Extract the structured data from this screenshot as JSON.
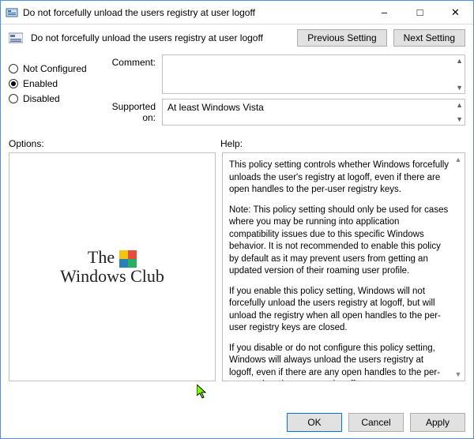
{
  "window": {
    "title": "Do not forcefully unload the users registry at user logoff"
  },
  "header": {
    "policy_name": "Do not forcefully unload the users registry at user logoff",
    "previous": "Previous Setting",
    "next": "Next Setting"
  },
  "state": {
    "not_configured": "Not Configured",
    "enabled": "Enabled",
    "disabled": "Disabled",
    "selected": "enabled"
  },
  "fields": {
    "comment_label": "Comment:",
    "comment_value": "",
    "supported_label": "Supported on:",
    "supported_value": "At least Windows Vista"
  },
  "labels": {
    "options": "Options:",
    "help": "Help:"
  },
  "watermark": {
    "line1": "The",
    "line2": "Windows Club"
  },
  "help_text": {
    "p1": "This policy setting  controls whether Windows forcefully unloads the user's registry at logoff, even if there are open handles to the per-user registry keys.",
    "p2": "Note: This policy setting should only be used for cases where you may be running into application compatibility issues due to this specific Windows behavior. It is not recommended to enable this policy by default as it may prevent users from getting an updated version of their roaming user profile.",
    "p3": "If you enable this policy setting, Windows will not forcefully unload the users registry at logoff, but will unload the registry when all open handles to the per-user registry keys are closed.",
    "p4": "If you disable or do not configure this policy setting, Windows will always unload the users registry at logoff, even if there are any open handles to the per-user registry keys at user logoff."
  },
  "footer": {
    "ok": "OK",
    "cancel": "Cancel",
    "apply": "Apply"
  }
}
